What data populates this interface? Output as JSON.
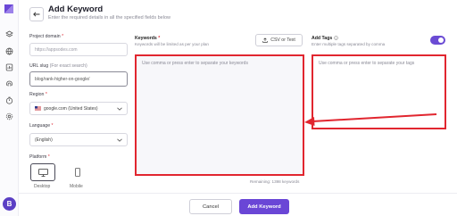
{
  "header": {
    "title": "Add Keyword",
    "subtitle": "Enter the required details in all the specified fields below"
  },
  "sidebar": {
    "avatar_initial": "B",
    "icons": [
      "logo-icon",
      "layers-icon",
      "globe-icon",
      "report-icon",
      "fingerprint-icon",
      "timer-icon",
      "settings-icon"
    ]
  },
  "form": {
    "project_domain": {
      "label": "Project domain",
      "required": "*",
      "placeholder": "https://appsodes.com"
    },
    "url_slug": {
      "label": "URL slug",
      "hint": "(For exact search)",
      "value": "blog/rank-higher-on-google/"
    },
    "region": {
      "label": "Region",
      "required": "*",
      "value": "google.com (United States)"
    },
    "language": {
      "label": "Language",
      "required": "*",
      "value": "(English)"
    },
    "platform": {
      "label": "Platform",
      "required": "*",
      "options": [
        "Desktop",
        "Mobile"
      ],
      "selected": "Desktop"
    }
  },
  "keywords": {
    "label": "Keywords",
    "required": "*",
    "hint": "Keywords will be limited as per your plan",
    "csv_button": "CSV or Text",
    "placeholder": "Use comma or press enter to separate your keywords",
    "remaining": "Remaining: 1398 keywords"
  },
  "tags": {
    "label": "Add Tags",
    "hint": "Enter multiple tags separated by comma",
    "placeholder": "Use comma or press enter to separate your tags",
    "toggle_on": true
  },
  "footer": {
    "cancel": "Cancel",
    "submit": "Add Keyword"
  },
  "colors": {
    "accent": "#6a46d6",
    "highlight": "#e1262f"
  }
}
